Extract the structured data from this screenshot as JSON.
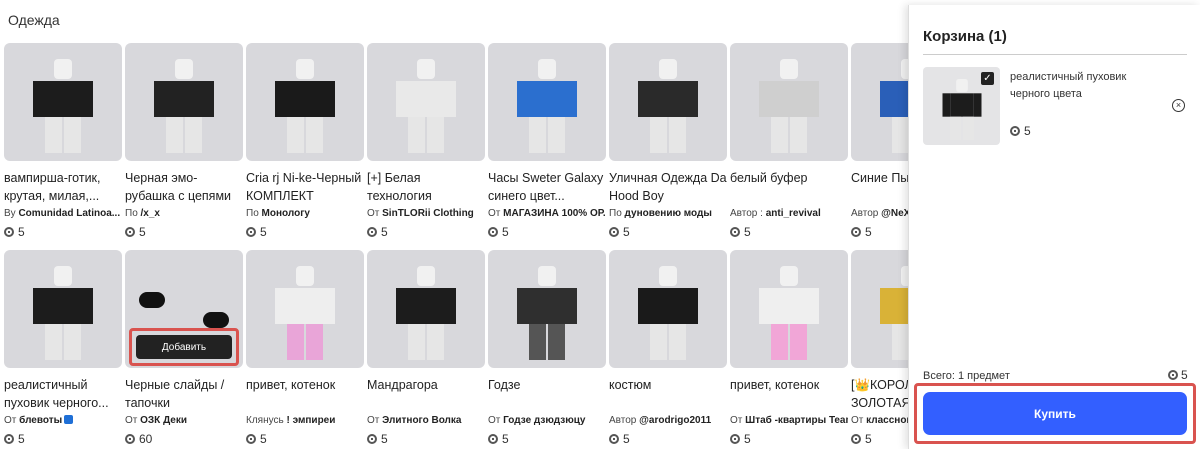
{
  "section_title": "Одежда",
  "row1": [
    {
      "name": "вампирша-готик, крутая, милая,...",
      "by": "By",
      "creator": "Comunidad Latinoa...",
      "verified": true,
      "price": "5"
    },
    {
      "name": "Черная эмо-рубашка с цепями ...",
      "by": "По",
      "creator": "/x_x",
      "verified": false,
      "price": "5"
    },
    {
      "name": "Cria rj Ni-ke-Черный КОМПЛЕКТ",
      "by": "По",
      "creator": "Монологу",
      "verified": false,
      "price": "5"
    },
    {
      "name": "[+] Белая технология",
      "by": "От",
      "creator": "SinTLORii Clothing",
      "verified": false,
      "price": "5"
    },
    {
      "name": "Часы Sweter Galaxy синего цвет...",
      "by": "От",
      "creator": "МАГАЗИНА 100% ОР...",
      "verified": false,
      "price": "5"
    },
    {
      "name": "Уличная Одежда Da Hood Boy",
      "by": "По",
      "creator": "дуновению моды",
      "verified": false,
      "price": "5"
    },
    {
      "name": "белый буфер",
      "by": "Автор :",
      "creator": "anti_revival",
      "verified": false,
      "price": "5"
    },
    {
      "name": "Синие Пылающи...",
      "by": "Автор",
      "creator": "@NeX",
      "verified": false,
      "price": "5"
    }
  ],
  "row2": [
    {
      "name": "реалистичный пуховик черного...",
      "by": "От",
      "creator": "блевоты",
      "verified": true,
      "price": "5"
    },
    {
      "name": "Черные слайды / тапочки",
      "by": "От",
      "creator": "ОЗК Деки",
      "verified": false,
      "price": "60",
      "add_label": "Добавить"
    },
    {
      "name": "привет, котенок",
      "by": "Клянусь",
      "creator": "! эмпиреи",
      "verified": false,
      "price": "5"
    },
    {
      "name": "Мандрагора",
      "by": "От",
      "creator": "Элитного Волка",
      "verified": false,
      "price": "5"
    },
    {
      "name": "Годзе",
      "by": "От",
      "creator": "Годзе дзюдзюцу",
      "verified": false,
      "price": "5"
    },
    {
      "name": "костюм",
      "by": "Автор",
      "creator": "@arodrigo2011",
      "verified": false,
      "price": "5"
    },
    {
      "name": "привет, котенок",
      "by": "От",
      "creator": "Штаб -квартиры Team...",
      "verified": false,
      "price": "5"
    },
    {
      "name": "[👑КОРОЛ ЗОЛОТАЯ...",
      "by": "От",
      "creator": "классного...",
      "verified": false,
      "price": "5"
    }
  ],
  "cart": {
    "title": "Корзина (1)",
    "item_name": "реалистичный пуховик\nчерного цвета",
    "item_price": "5",
    "total_label": "Всего: 1 предмет",
    "total_price": "5",
    "buy_label": "Купить",
    "check": "✓",
    "remove": "×"
  },
  "colors": {
    "buy_button": "#335fff",
    "highlight": "#d9534f",
    "thumb_bg": "#d8d8dc"
  }
}
